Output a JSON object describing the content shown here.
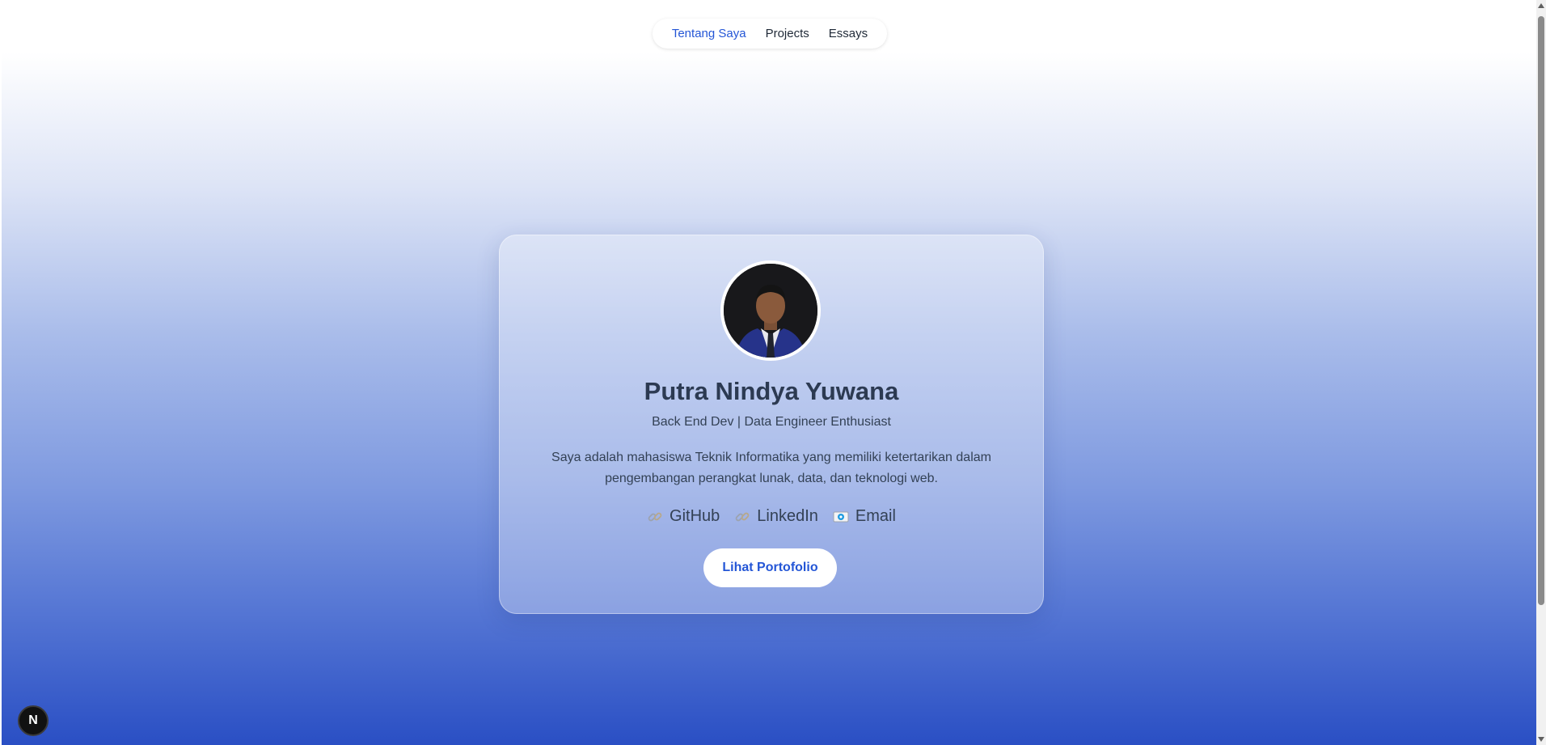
{
  "nav": {
    "items": [
      {
        "label": "Tentang Saya",
        "active": true
      },
      {
        "label": "Projects",
        "active": false
      },
      {
        "label": "Essays",
        "active": false
      }
    ]
  },
  "profile": {
    "name": "Putra Nindya Yuwana",
    "role": "Back End Dev | Data Engineer Enthusiast",
    "bio": "Saya adalah mahasiswa Teknik Informatika yang memiliki ketertarikan dalam pengembangan perangkat lunak, data, dan teknologi web.",
    "avatar_icon": "profile-photo"
  },
  "links": [
    {
      "label": "GitHub",
      "icon": "link-icon"
    },
    {
      "label": "LinkedIn",
      "icon": "link-icon"
    },
    {
      "label": "Email",
      "icon": "email-icon"
    }
  ],
  "cta": {
    "label": "Lihat Portofolio"
  },
  "dev_badge": {
    "label": "N"
  },
  "colors": {
    "accent": "#2456d6",
    "text": "#334155",
    "heading": "#2c3a52",
    "gradient_bottom": "#2a4fc4"
  }
}
